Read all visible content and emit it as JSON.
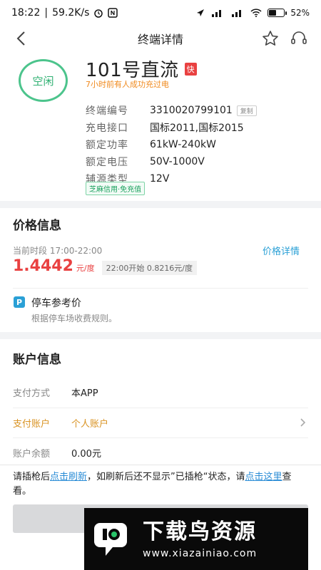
{
  "statusbar": {
    "time": "18:22",
    "network_speed": "59.2K/s",
    "battery_text": "52%",
    "battery_level": 0.52
  },
  "navbar": {
    "title": "终端详情"
  },
  "station": {
    "status": "空闲",
    "name": "101号直流",
    "fast_badge": "快",
    "last_charge": "7小时前有人成功充过电",
    "credit_tag": "芝麻信用·免充值",
    "copy_label": "复制",
    "fields": [
      {
        "key": "终端编号",
        "value": "3310020799101"
      },
      {
        "key": "充电接口",
        "value": "国标2011,国标2015"
      },
      {
        "key": "额定功率",
        "value": "61kW-240kW"
      },
      {
        "key": "额定电压",
        "value": "50V-1000V"
      },
      {
        "key": "辅源类型",
        "value": "12V"
      }
    ]
  },
  "price": {
    "section_title": "价格信息",
    "period": "当前时段 17:00-22:00",
    "detail_link": "价格详情",
    "current_price": "1.4442",
    "unit": "元/度",
    "next_price": "22:00开始  0.8216元/度"
  },
  "parking": {
    "icon_letter": "P",
    "title": "停车参考价",
    "desc": "根据停车场收费规则。"
  },
  "account": {
    "section_title": "账户信息",
    "rows": [
      {
        "key": "支付方式",
        "value": "本APP"
      },
      {
        "key": "支付账户",
        "value": "个人账户"
      },
      {
        "key": "账户余额",
        "value": "0.00元"
      }
    ]
  },
  "notice": {
    "part1": "请插枪后",
    "link1": "点击刷新",
    "part2": "，如刷新后还不显示”已插枪“状态，请",
    "link2": "点击这里",
    "part3": "查看。"
  },
  "watermark": {
    "title": "下载鸟资源",
    "url": "www.xiazainiao.com"
  },
  "colors": {
    "accent_green": "#4cc48c",
    "price_red": "#e94141",
    "link_blue": "#2a8cd6",
    "orange": "#d99323"
  }
}
